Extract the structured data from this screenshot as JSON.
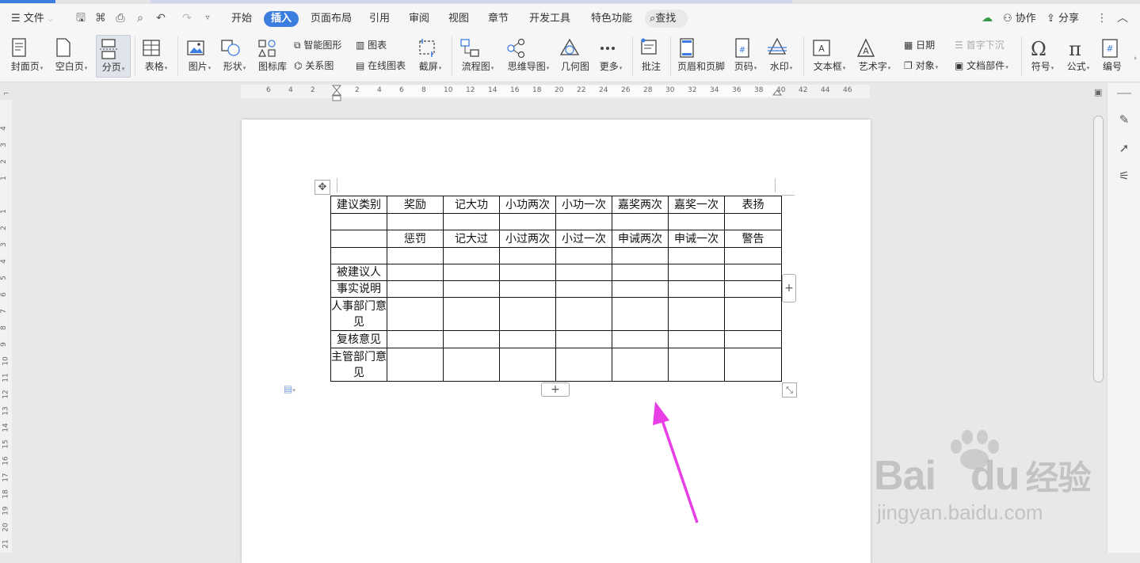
{
  "menubar": {
    "file_label": "文件",
    "tabs": [
      "开始",
      "插入",
      "页面布局",
      "引用",
      "审阅",
      "视图",
      "章节",
      "开发工具",
      "特色功能"
    ],
    "active_tab": "插入",
    "search_label": "查找",
    "collab_label": "协作",
    "share_label": "分享"
  },
  "ribbon": {
    "cover_page": "封面页",
    "blank_page": "空白页",
    "page_break": "分页",
    "table": "表格",
    "picture": "图片",
    "shape": "形状",
    "icon_library": "图标库",
    "smart_graphic": "智能图形",
    "relation_graph": "关系图",
    "chart": "图表",
    "online_chart": "在线图表",
    "screenshot": "截屏",
    "flowchart": "流程图",
    "mind_map": "思维导图",
    "geometry": "几何图",
    "more": "更多",
    "comment": "批注",
    "header_footer": "页眉和页脚",
    "page_number": "页码",
    "watermark": "水印",
    "text_box": "文本框",
    "word_art": "艺术字",
    "date": "日期",
    "object": "对象",
    "drop_cap": "首字下沉",
    "doc_parts": "文档部件",
    "symbol": "符号",
    "formula": "公式",
    "numbering": "编号"
  },
  "ruler": {
    "h_ticks": [
      "6",
      "4",
      "2",
      "2",
      "4",
      "6",
      "8",
      "10",
      "12",
      "14",
      "16",
      "18",
      "20",
      "22",
      "24",
      "26",
      "28",
      "30",
      "32",
      "34",
      "36",
      "38",
      "40",
      "42",
      "44",
      "46"
    ],
    "v_ticks": [
      "4",
      "3",
      "2",
      "1",
      "1",
      "2",
      "3",
      "4",
      "5",
      "6",
      "7",
      "8",
      "9",
      "10",
      "11",
      "12",
      "13",
      "14",
      "15",
      "16",
      "17",
      "18",
      "19",
      "20",
      "21"
    ]
  },
  "table": {
    "rows": [
      [
        "建议类别",
        "奖励",
        "记大功",
        "小功两次",
        "小功一次",
        "嘉奖两次",
        "嘉奖一次",
        "表扬"
      ],
      [
        "",
        "",
        "",
        "",
        "",
        "",
        "",
        ""
      ],
      [
        "",
        "惩罚",
        "记大过",
        "小过两次",
        "小过一次",
        "申诫两次",
        "申诫一次",
        "警告"
      ],
      [
        "",
        "",
        "",
        "",
        "",
        "",
        "",
        ""
      ],
      [
        "被建议人",
        "",
        "",
        "",
        "",
        "",
        "",
        ""
      ],
      [
        "事实说明",
        "",
        "",
        "",
        "",
        "",
        "",
        ""
      ],
      [
        "人事部门意见",
        "",
        "",
        "",
        "",
        "",
        "",
        ""
      ],
      [
        "复核意见",
        "",
        "",
        "",
        "",
        "",
        "",
        ""
      ],
      [
        "主管部门意见",
        "",
        "",
        "",
        "",
        "",
        "",
        ""
      ]
    ]
  },
  "watermark": {
    "brand": "Bai",
    "brand2": "du",
    "cn": "经验",
    "url": "jingyan.baidu.com"
  },
  "colors": {
    "accent": "#3c7ee0",
    "arrow": "#e83ee6"
  }
}
